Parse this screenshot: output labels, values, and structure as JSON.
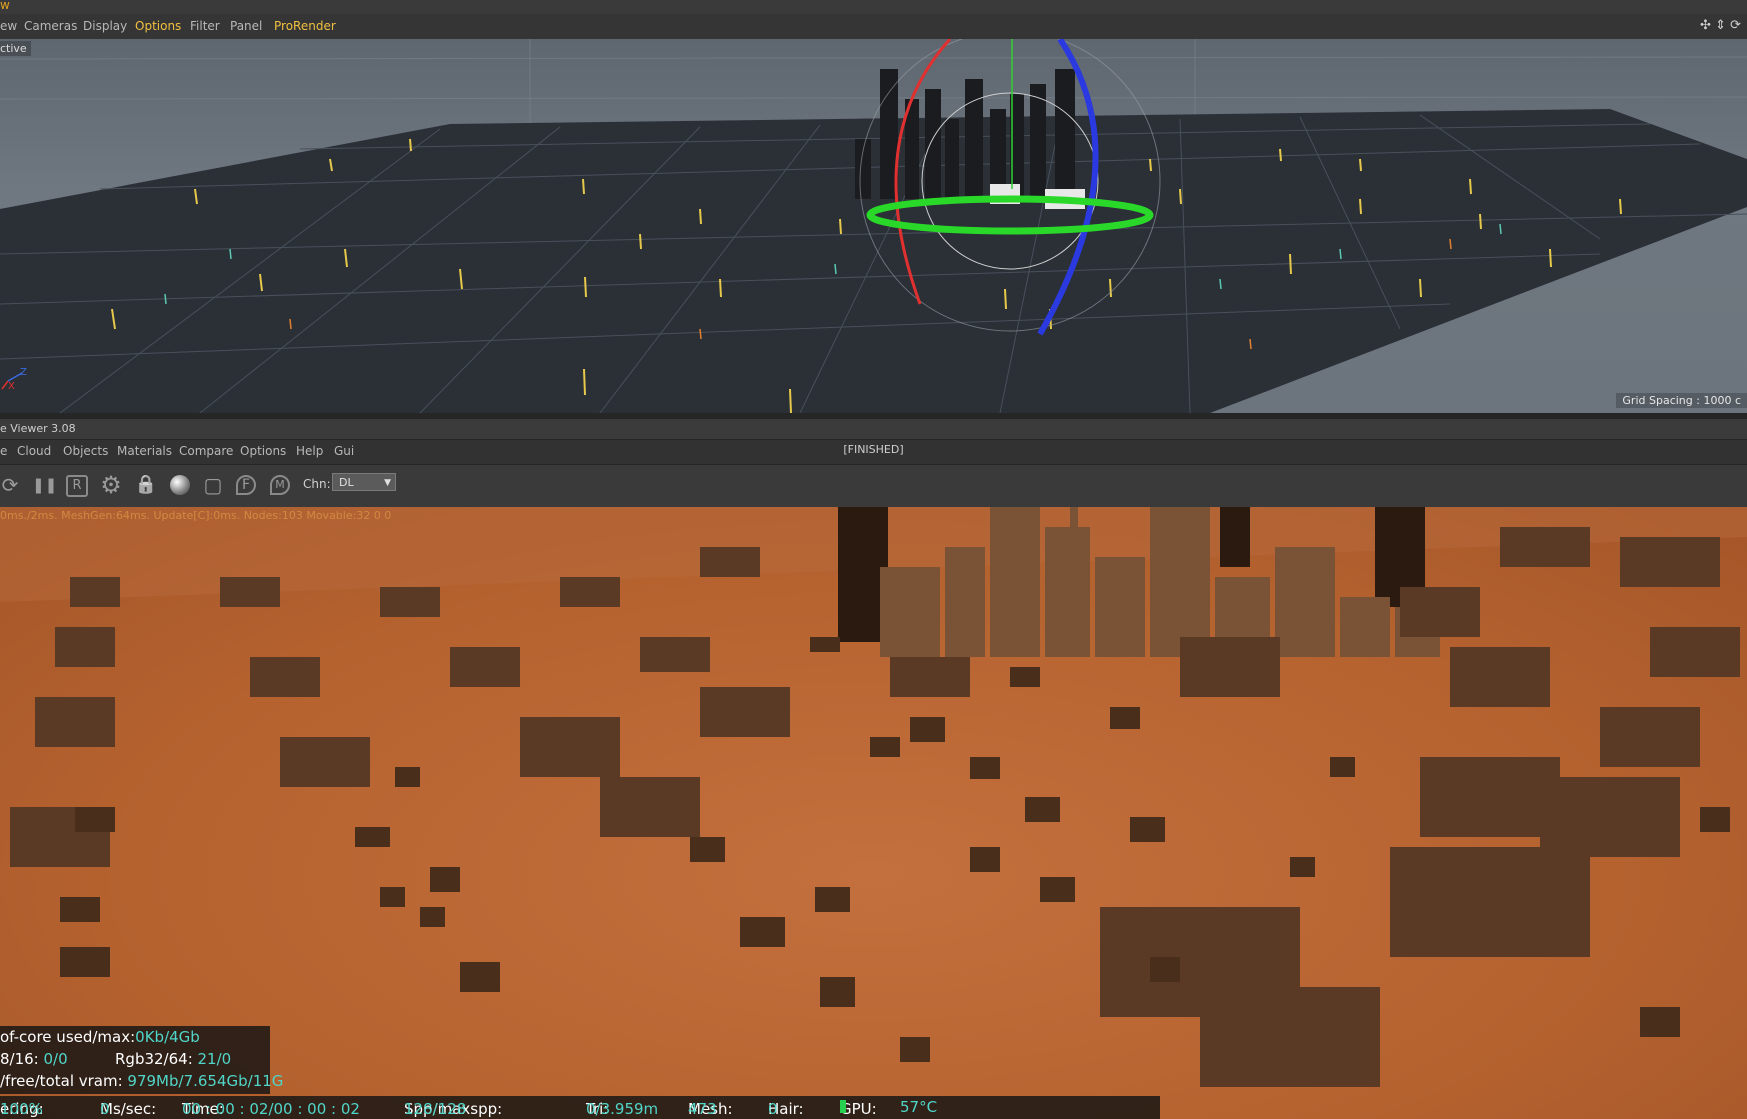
{
  "window": {
    "title_fragment": "w"
  },
  "viewport_menu": {
    "items": [
      {
        "label": "ew",
        "highlight": false
      },
      {
        "label": "Cameras",
        "highlight": false
      },
      {
        "label": "Display",
        "highlight": false
      },
      {
        "label": "Options",
        "highlight": true
      },
      {
        "label": "Filter",
        "highlight": false
      },
      {
        "label": "Panel",
        "highlight": false
      },
      {
        "label": "ProRender",
        "highlight": true
      }
    ],
    "nav_icons": "✣ ⇕ ⟳"
  },
  "viewport": {
    "camera_label": "ctive",
    "grid_spacing": "Grid Spacing : 1000 c",
    "axis_z": "Z",
    "axis_x": "X"
  },
  "live_viewer": {
    "title": "e Viewer 3.08",
    "menu": [
      "e",
      "Cloud",
      "Objects",
      "Materials",
      "Compare",
      "Options",
      "Help",
      "Gui"
    ],
    "status": "[FINISHED]",
    "toolbar_icons": [
      "refresh-icon",
      "pause-icon",
      "region-render-icon",
      "settings-icon",
      "lock-icon",
      "material-ball-icon",
      "clay-icon",
      "focus-pick-icon",
      "material-pick-icon"
    ],
    "toolbar_glyphs": {
      "refresh": "⟳",
      "pause": "❚❚",
      "region": "R",
      "settings": "⚙",
      "lock": "🔒",
      "clay": "▢",
      "focus": "F",
      "matpick": "M"
    },
    "chn_label": "Chn:",
    "chn_value": "DL",
    "render_stats": "0ms./2ms. MeshGen:64ms. Update[C]:0ms. Nodes:103 Movable:32  0 0"
  },
  "stats": {
    "row1_label": "of-core used/max:",
    "row1_value": "0Kb/4Gb",
    "row2_label": "8/16: ",
    "row2_value": "0/0",
    "row2b_label": "Rgb32/64: ",
    "row2b_value": "21/0",
    "row3_label": "/free/total vram: ",
    "row3_value": "979Mb/7.654Gb/11G"
  },
  "bottom_bar": {
    "rendering_label": "ering: ",
    "rendering_value": "100%",
    "mssec_label": "Ms/sec: ",
    "mssec_value": "0",
    "time_label": "Time: ",
    "time_value": "00 : 00 : 02/00 : 00 : 02",
    "spp_label": "Spp/maxspp: ",
    "spp_value": "128/128",
    "tri_label": "Tri: ",
    "tri_value": "0/3.959m",
    "mesh_label": "Mesh: ",
    "mesh_value": "473",
    "hair_label": "Hair: ",
    "hair_value": "0",
    "gpu_label": "GPU:",
    "gpu_temp": "57°C"
  }
}
